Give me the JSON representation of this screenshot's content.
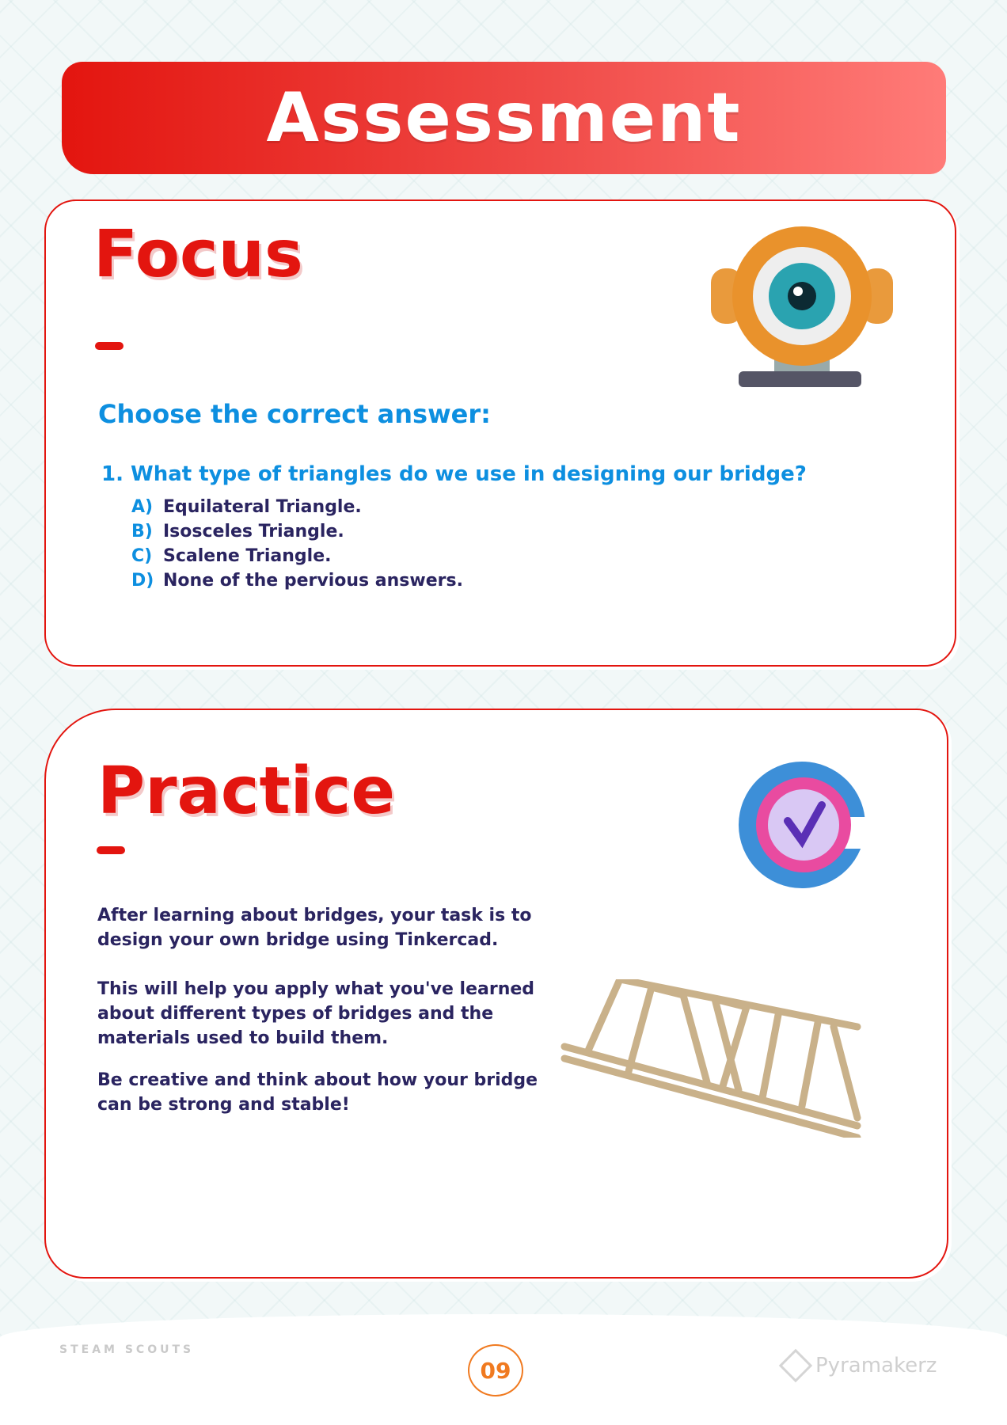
{
  "header": {
    "title": "Assessment"
  },
  "focus": {
    "title": "Focus",
    "instruction": "Choose the correct answer:",
    "question": "1. What type of triangles do we use in designing our bridge?",
    "options": [
      {
        "letter": "A)",
        "text": "Equilateral Triangle."
      },
      {
        "letter": "B)",
        "text": "Isosceles Triangle."
      },
      {
        "letter": "C)",
        "text": "Scalene Triangle."
      },
      {
        "letter": "D)",
        "text": "None of the pervious answers."
      }
    ]
  },
  "practice": {
    "title": "Practice",
    "paragraphs": [
      "After learning about bridges, your task is to design your own bridge using Tinkercad.",
      "This will help you apply what you've learned about different types of bridges and the materials used to build them.",
      "Be creative and think about how your bridge can be strong and stable!"
    ]
  },
  "footer": {
    "page_number": "09",
    "left_logo": "STEAM SCOUTS",
    "right_logo": "Pyramakerz"
  },
  "colors": {
    "red": "#e3150f",
    "blue": "#0d8fe0",
    "navy": "#2a2460",
    "orange": "#f07a20"
  }
}
